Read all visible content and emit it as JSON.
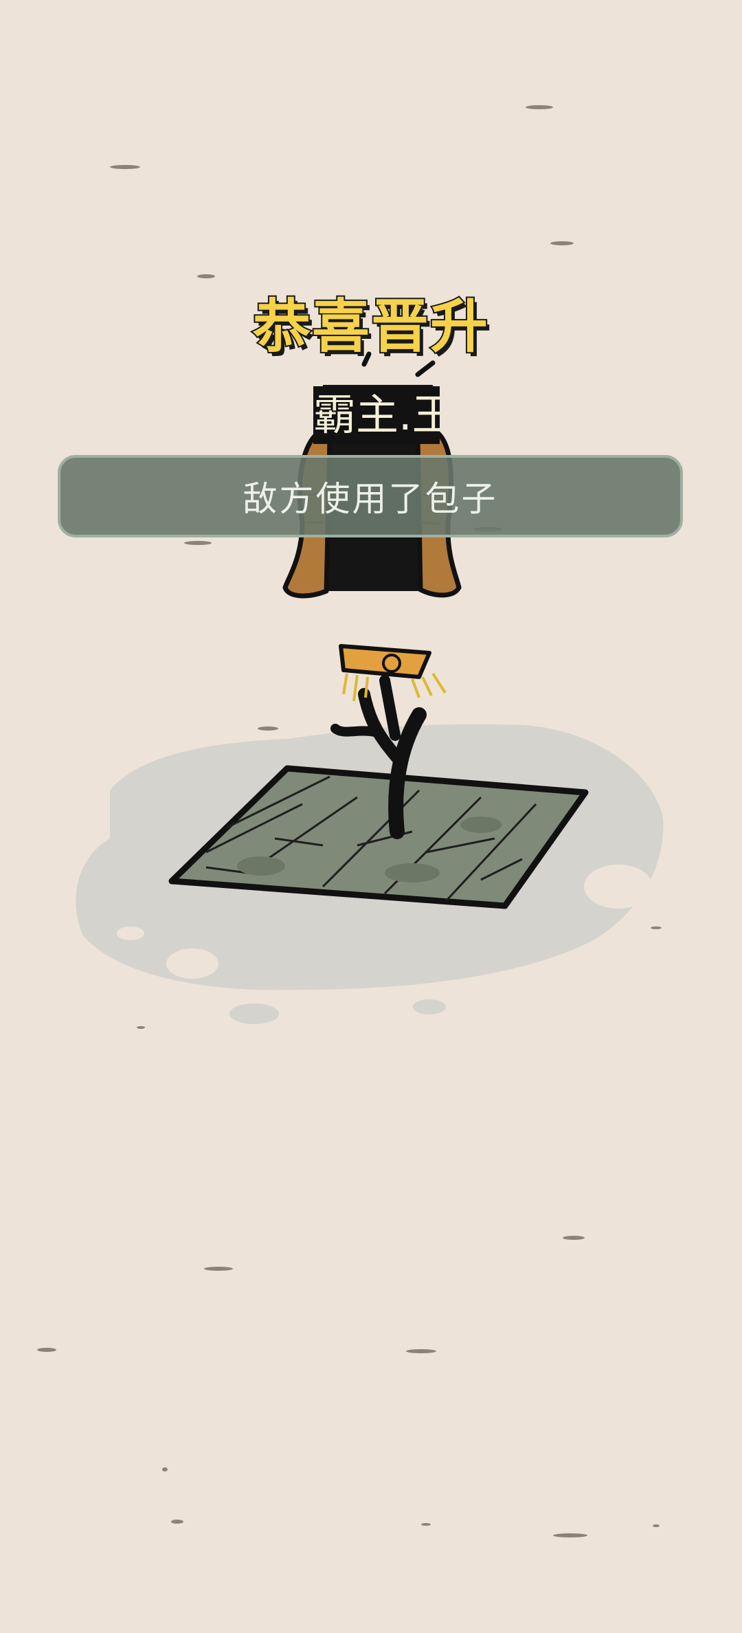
{
  "scene": {
    "promotion_title": "恭喜晋升",
    "character_name": "霸主.王",
    "toast_message": "敌方使用了包子"
  },
  "colors": {
    "background": "#ede3d8",
    "title_fill": "#f6d24a",
    "toast_bg": "#6e7a70",
    "tile": "#7f8a78"
  }
}
